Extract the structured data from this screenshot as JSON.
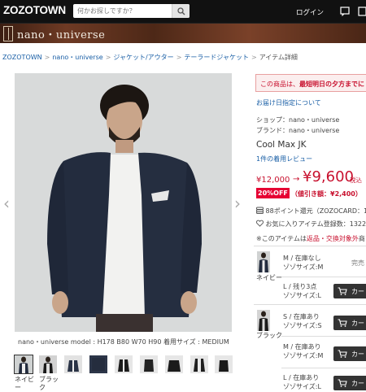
{
  "header": {
    "logo": "ZOZOTOWN",
    "search_placeholder": "何かお探しですか？",
    "login": "ログイン"
  },
  "brand_bar": {
    "name": "nano・universe"
  },
  "breadcrumb": [
    "ZOZOTOWN",
    "nano・universe",
    "ジャケット/アウター",
    "テーラードジャケット",
    "アイテム詳細"
  ],
  "image": {
    "caption": "nano・universe model : H178 B80 W70 H90 着用サイズ : MEDIUM",
    "thumb_labels": [
      "ネイビー",
      "ブラック"
    ]
  },
  "product": {
    "notice_prefix": "この商品は、",
    "notice_bold": "最短明日の夕方までに",
    "delivery_link": "お届け日指定について",
    "shop_line": "ショップ：nano・universe",
    "brand_line": "ブランド：nano・universe",
    "name": "Cool Max JK",
    "review_link": "1件の着用レビュー",
    "old_price": "¥12,000",
    "arrow": "→",
    "price": "¥9,600",
    "tax": "税込",
    "off_badge": "20%OFF",
    "discount_text": "（値引き額：¥2,400）",
    "points_text": "88ポイント還元（ZOZOCARD：1",
    "favorites_text": "お気に入りアイテム登録数：1322",
    "warning_prefix": "※このアイテムは",
    "warning_red": "返品・交換対象外",
    "warning_suffix": "商"
  },
  "variants": [
    {
      "color": "ネイビー",
      "sizes": [
        {
          "size": "M / 在庫なし",
          "zozo": "ゾゾサイズ:M",
          "action": "完売"
        },
        {
          "size": "L / 残り3点",
          "zozo": "ゾゾサイズ:L",
          "action": "カート"
        }
      ]
    },
    {
      "color": "ブラック",
      "sizes": [
        {
          "size": "S / 在庫あり",
          "zozo": "ゾゾサイズ:S",
          "action": "カート"
        },
        {
          "size": "M / 在庫あり",
          "zozo": "ゾゾサイズ:M",
          "action": "カート"
        },
        {
          "size": "L / 在庫あり",
          "zozo": "ゾゾサイズ:L",
          "action": "カート"
        }
      ]
    }
  ],
  "colors": {
    "accent_red": "#c8102e",
    "off_badge": "#e60033",
    "link": "#1a5fa6",
    "header": "#111111"
  }
}
